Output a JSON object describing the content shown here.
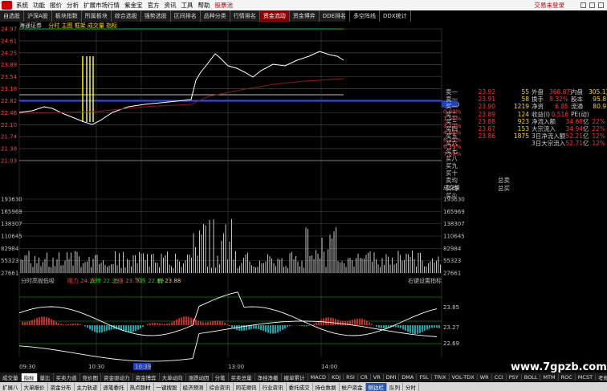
{
  "menu": {
    "items": [
      "系统",
      "功能",
      "报价",
      "分析",
      "扩展市场行情",
      "资讯",
      "工具",
      "帮助"
    ],
    "extra": [
      "紫金宝",
      "官方",
      "资讯"
    ],
    "broker": "股票池",
    "trade_link": "交易未登录"
  },
  "top_tabs": [
    "自选股",
    "沪深A股",
    "板块指数",
    "所属板块",
    "综合选股",
    "强势选股",
    "区间排名",
    "品种分类",
    "行情排名",
    "资金流动",
    "资金博弈",
    "DDE排名",
    "多空阵线",
    "DDX统计"
  ],
  "chart_title": {
    "name": "海通证券",
    "sub": "分时 主图 框架 成交量 指标"
  },
  "price_axis_left": [
    "24.97",
    "24.61",
    "24.25",
    "23.89",
    "23.54",
    "23.18",
    "22.82",
    "22.46",
    "22.10",
    "21.74",
    "21.38",
    "21.03"
  ],
  "price_axis_right": [
    "22.60",
    "0.00%",
    "1.56%",
    "3.12%",
    "4.68%",
    "6.25%",
    "6.39%",
    "7.80%"
  ],
  "volume_axis_left": [
    "193630",
    "165969",
    "138307",
    "110645",
    "82984",
    "55323",
    "27661"
  ],
  "volume_axis_right": [
    "193630",
    "165969",
    "138307",
    "110645",
    "82984",
    "55323",
    "27661"
  ],
  "volume_top_label": "成交量",
  "indicator": {
    "title": "分时高抛低吸",
    "labels": [
      {
        "k": "阻力",
        "v": "24.20",
        "c": "#ff4444"
      },
      {
        "k": "支撑",
        "v": "22.39",
        "c": "#00cc00"
      },
      {
        "k": "上涨",
        "v": "23.70",
        "c": "#ff4444"
      },
      {
        "k": "下跌",
        "v": "22.89",
        "c": "#00cc00"
      },
      {
        "k": "价",
        "v": "23.88",
        "c": "#ffd700"
      }
    ],
    "right_title": "右键设置指标",
    "axis": [
      "23.85",
      "23.27",
      "22.69"
    ]
  },
  "time_axis": [
    "09:30",
    "10:30",
    "10:39",
    "13:00",
    "14:00"
  ],
  "order_book": [
    {
      "l": "卖一",
      "p": "23.92",
      "v": "55",
      "c": "r"
    },
    {
      "l": "卖一",
      "p": "23.91",
      "v": "58",
      "c": "r"
    },
    {
      "l": "买一",
      "p": "23.90",
      "v": "1219",
      "c": "r"
    },
    {
      "l": "买二",
      "p": "23.89",
      "v": "124",
      "c": "r"
    },
    {
      "l": "买三",
      "p": "23.88",
      "v": "923",
      "c": "r"
    },
    {
      "l": "买四",
      "p": "23.87",
      "v": "153",
      "c": "r"
    },
    {
      "l": "买五",
      "p": "23.86",
      "v": "1875",
      "c": "r"
    }
  ],
  "order_book_more": [
    "买六",
    "买七",
    "买八",
    "买九",
    "买十"
  ],
  "stats": [
    {
      "k": "外盘",
      "v1": "368.8万",
      "k2": "内盘",
      "v2": "305.1万"
    },
    {
      "k": "换手",
      "v1": "8.32%",
      "k2": "股本",
      "v2": "95.8"
    },
    {
      "k": "净资",
      "v1": "6.85",
      "k2": "流通",
      "v2": "80.9"
    },
    {
      "k": "收益(I)",
      "v1": "0.516",
      "k2": "PE(动)",
      "v2": ""
    }
  ],
  "flow": [
    {
      "k": "净流入额",
      "v": "34.68",
      "u": "亿",
      "pct": "22%"
    },
    {
      "k": "大宗流入",
      "v": "34.94",
      "u": "亿",
      "pct": "22%"
    },
    {
      "k": "3日净流入额",
      "v": "52.21",
      "u": "亿",
      "pct": "12%"
    },
    {
      "k": "3日大宗流入",
      "v": "52.71",
      "u": "亿",
      "pct": "12%"
    }
  ],
  "seal": {
    "sell": "卖均",
    "buy": "买均",
    "sell_total": "总卖",
    "buy_total": "总买",
    "open_label": "买①",
    "bottom_label": "买①"
  },
  "bottom_tabs": [
    "成交量",
    "指标",
    "量比",
    "买卖力道",
    "竞价图",
    "资金驱动力",
    "资金博弈",
    "大单动向",
    "涨跌动因",
    "分笔",
    "买卖总量",
    "净挂净撤",
    "撤单累计",
    "MACD",
    "KDJ",
    "RSI",
    "CR",
    "VR",
    "DMI",
    "DMA",
    "FSL",
    "TRIX",
    "VOL-TDX",
    "WR",
    "CCI",
    "PSY",
    "BOLL",
    "MTM",
    "ROC",
    "MCST",
    "考规"
  ],
  "status_tabs": [
    "扩展八",
    "大单报价",
    "资金分布",
    "主力轨迹",
    "逐笔委托",
    "热点题材",
    "一键搜股",
    "经济预测",
    "综合资讯",
    "同花顺讯",
    "行业资讯",
    "委托成交",
    "持仓数据",
    "帐户资金",
    "侧边栏",
    "队列",
    "分时"
  ],
  "watermark": "www.7gpzb.com",
  "colors": {
    "price_line": "#ffffff",
    "avg_line": "#ffd700",
    "up": "#ff3333",
    "down": "#00cc00",
    "volume": "#c8c8c8",
    "cyan": "#00e5ee"
  }
}
